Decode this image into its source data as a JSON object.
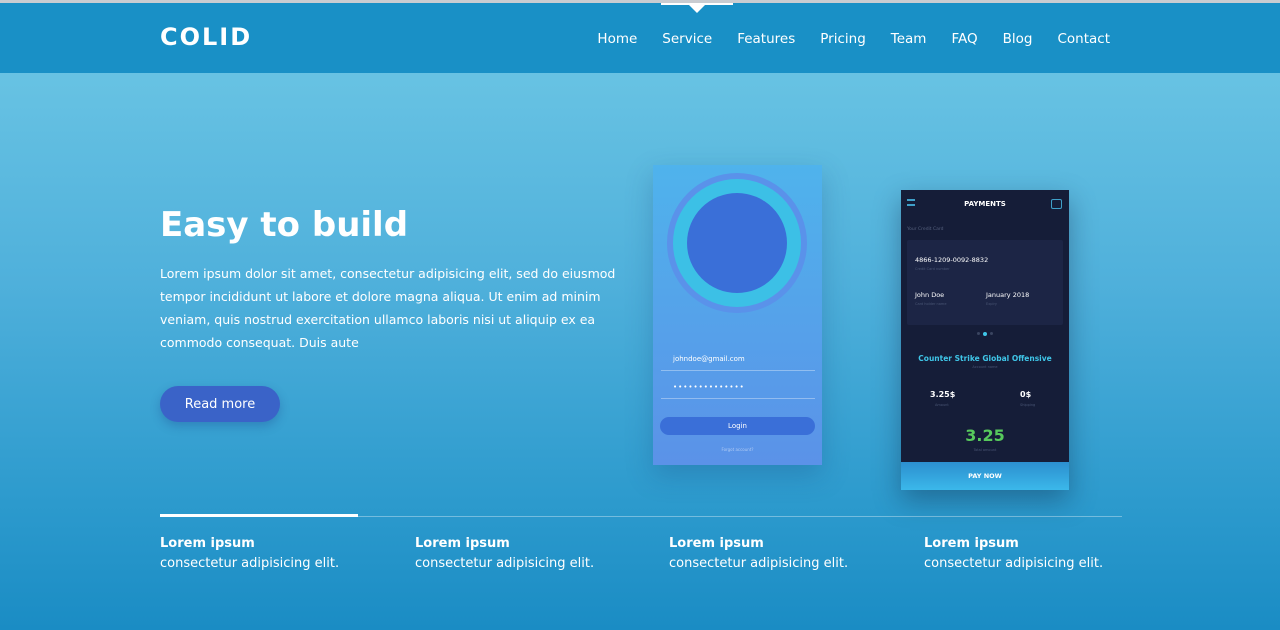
{
  "header": {
    "logo": "COLID",
    "nav": [
      "Home",
      "Service",
      "Features",
      "Pricing",
      "Team",
      "FAQ",
      "Blog",
      "Contact"
    ],
    "active_nav": "Service"
  },
  "hero": {
    "title": "Easy to build",
    "text": "Lorem ipsum dolor sit amet, consectetur adipisicing elit, sed do eiusmod tempor incididunt ut labore et dolore magna aliqua. Ut enim ad minim veniam, quis nostrud exercitation ullamco laboris nisi ut aliquip ex ea commodo consequat. Duis aute",
    "button": "Read more"
  },
  "login_mock": {
    "email": "johndoe@gmail.com",
    "password": "••••••••••••••",
    "button": "Login",
    "forgot": "Forgot account?"
  },
  "payments_mock": {
    "title": "PAYMENTS",
    "card_label": "Your Credit Card",
    "card_number": "4866-1209-0092-8832",
    "card_number_sub": "Credit Card number",
    "name": "John Doe",
    "name_sub": "Card holder name",
    "date": "January 2018",
    "date_sub": "Expiry",
    "game": "Counter Strike Global Offensive",
    "game_sub": "Account name",
    "amount1": "3.25$",
    "amount1_sub": "Amount",
    "amount2": "0$",
    "amount2_sub": "Shipping",
    "total": "3.25",
    "total_sub": "Total amount",
    "pay": "PAY NOW"
  },
  "features": [
    {
      "title": "Lorem ipsum",
      "desc": "consectetur adipisicing elit."
    },
    {
      "title": "Lorem ipsum",
      "desc": "consectetur adipisicing elit."
    },
    {
      "title": "Lorem ipsum",
      "desc": "consectetur adipisicing elit."
    },
    {
      "title": "Lorem ipsum",
      "desc": "consectetur adipisicing elit."
    }
  ],
  "colors": {
    "header_bg": "#1990c6",
    "button_bg": "#3a63c8",
    "accent_cyan": "#3fc6e8",
    "total_green": "#57c95c"
  }
}
